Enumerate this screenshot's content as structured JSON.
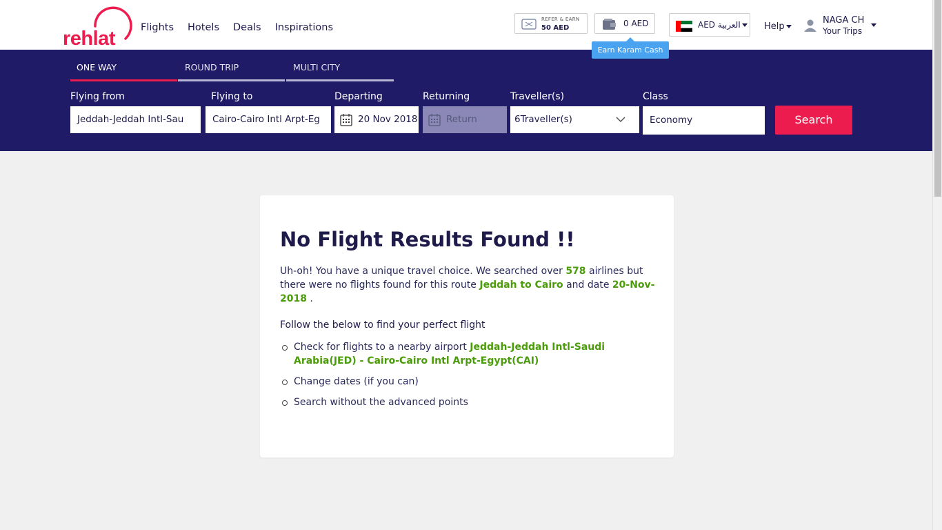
{
  "header": {
    "logo_text": "rehlat",
    "nav": [
      "Flights",
      "Hotels",
      "Deals",
      "Inspirations"
    ],
    "refer_label": "REFER & EARN",
    "refer_amount": "50 AED",
    "wallet_amount": "0 AED",
    "tooltip": "Earn Karam Cash",
    "currency": "AED العربية",
    "help": "Help",
    "user_name": "NAGA CH",
    "user_trips": "Your Trips"
  },
  "search": {
    "tabs": [
      "ONE WAY",
      "ROUND TRIP",
      "MULTI CITY"
    ],
    "active_tab": "ONE WAY",
    "labels": {
      "from": "Flying from",
      "to": "Flying to",
      "departing": "Departing",
      "returning": "Returning",
      "travellers": "Traveller(s)",
      "class": "Class"
    },
    "from_value": "Jeddah-Jeddah Intl-Sau",
    "to_value": "Cairo-Cairo Intl Arpt-Eg",
    "departing_value": "20 Nov 2018",
    "returning_placeholder": "Return",
    "travellers_value": "6Traveller(s)",
    "class_value": "Economy",
    "search_button": "Search"
  },
  "result": {
    "title": "No Flight Results Found !!",
    "p1_a": "Uh-oh! You have a unique travel choice. We searched over ",
    "airline_count": "578",
    "p1_b": " airlines but there were no flights found for this route ",
    "route": "Jeddah to Cairo",
    "p1_c": " and date ",
    "date": "20-Nov-2018",
    "p1_d": " .",
    "follow": "Follow the below to find your perfect flight",
    "tip1_a": "Check for flights to a nearby airport ",
    "tip1_airports": "Jeddah-Jeddah Intl-Saudi Arabia(JED) - Cairo-Cairo Intl Arpt-Egypt(CAI)",
    "tip2": "Change dates (if you can)",
    "tip3": "Search without the advanced points"
  },
  "colors": {
    "brand_red": "#ed1c4f",
    "band_navy": "#201b66",
    "highlight_green": "#4a9c0a",
    "tooltip_blue": "#4aa3f0"
  }
}
